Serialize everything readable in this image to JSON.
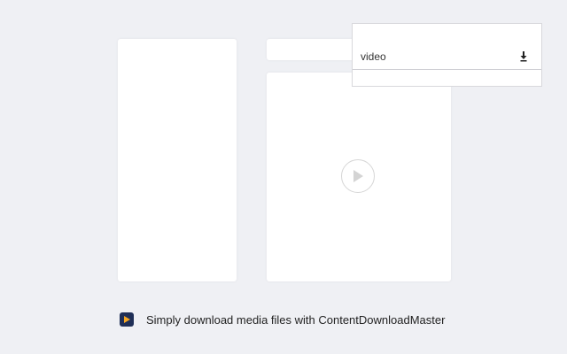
{
  "popup": {
    "item_label": "video",
    "download_icon": "download-arrow-icon"
  },
  "media": {
    "play_icon": "play-icon"
  },
  "footer": {
    "logo_icon": "play-logo-icon",
    "tagline": "Simply download media files with ContentDownloadMaster"
  },
  "colors": {
    "background": "#eff0f4",
    "card": "#ffffff",
    "logo_bg": "#1f2f57",
    "logo_accent": "#f5a623"
  }
}
